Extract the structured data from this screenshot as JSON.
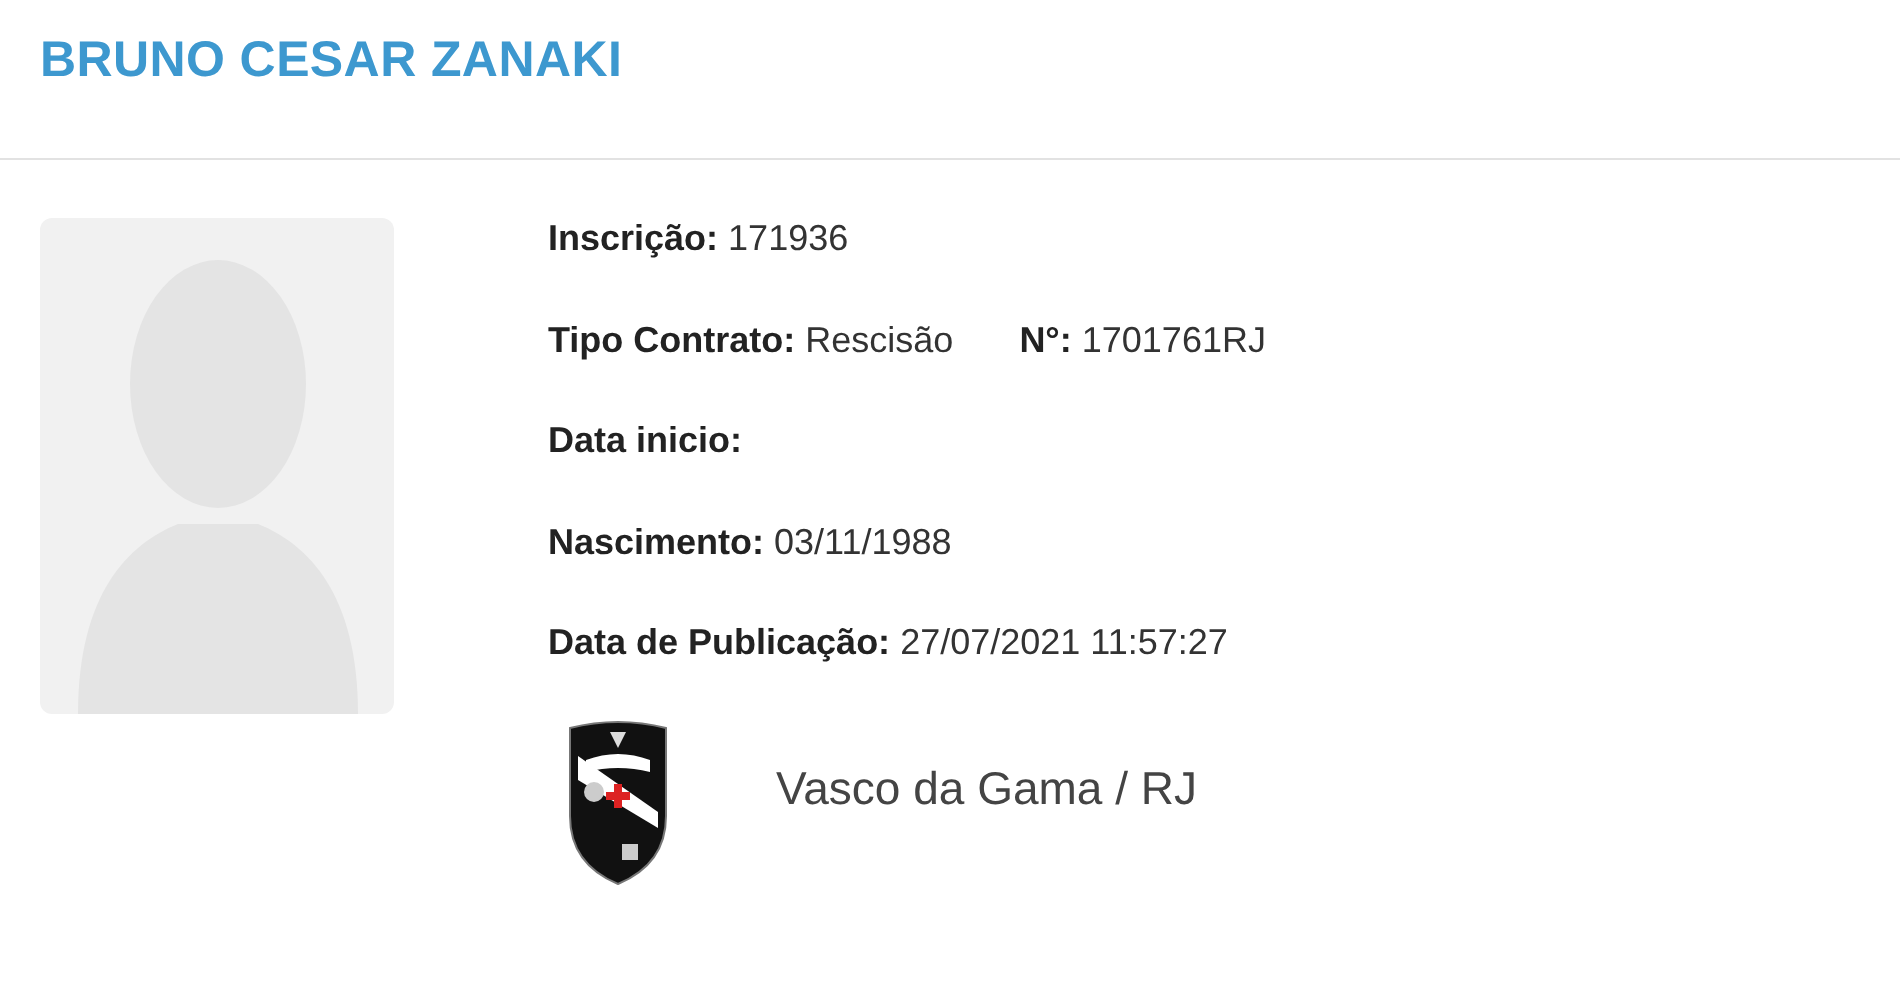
{
  "title": "BRUNO CESAR ZANAKI",
  "photo": {
    "kind": "placeholder"
  },
  "fields": [
    {
      "items": [
        {
          "label": "Inscrição:",
          "value": "171936"
        }
      ]
    },
    {
      "items": [
        {
          "label": "Tipo Contrato:",
          "value": "Rescisão"
        },
        {
          "label": "N°:",
          "value": "1701761RJ"
        }
      ]
    },
    {
      "items": [
        {
          "label": "Data inicio:"
        }
      ]
    },
    {
      "items": [
        {
          "label": "Nascimento:",
          "value": "03/11/1988"
        }
      ]
    },
    {
      "items": [
        {
          "label": "Data de Publicação:",
          "value": "27/07/2021 11:57:27"
        }
      ]
    }
  ],
  "club": {
    "name": "Vasco da Gama / RJ"
  }
}
